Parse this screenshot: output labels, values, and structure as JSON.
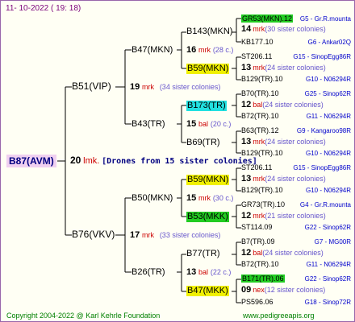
{
  "header": {
    "date": "11-  10-2022  ( 19:  18)"
  },
  "root": {
    "label": "B87(AVM)",
    "count": "20",
    "unit": "lmk.",
    "note": "[Drones from 15 sister colonies]"
  },
  "gen1": [
    {
      "label": "B51(VIP)",
      "count": "19",
      "unit": "mrk",
      "note": "(34 sister colonies)"
    },
    {
      "label": "B76(VKV)",
      "count": "17",
      "unit": "mrk",
      "note": "(33 sister colonies)"
    }
  ],
  "gen2": [
    {
      "label": "B47(MKN)",
      "count": "16",
      "unit": "mrk",
      "note": "(28 c.)"
    },
    {
      "label": "B43(TR)",
      "count": "15",
      "unit": "bal",
      "note": "(20 c.)"
    },
    {
      "label": "B50(MKN)",
      "count": "15",
      "unit": "mrk",
      "note": "(30 c.)"
    },
    {
      "label": "B26(TR)",
      "count": "13",
      "unit": "bal",
      "note": "(22 c.)"
    }
  ],
  "gen3": [
    {
      "label": "B143(MKN)"
    },
    {
      "label": "B59(MKN)"
    },
    {
      "label": "B173(TR)"
    },
    {
      "label": "B69(TR)"
    },
    {
      "label": "B59(MKN)"
    },
    {
      "label": "B53(MKK)"
    },
    {
      "label": "B77(TR)"
    },
    {
      "label": "B47(MKK)"
    }
  ],
  "gen4": [
    {
      "sire": "GR53(MKN).12",
      "queen": "G5 - Gr.R.mounta"
    },
    {
      "count": "14",
      "unit": "mrk",
      "note": "(30 sister colonies)"
    },
    {
      "sire": "KB177.10",
      "queen": "G6 - Ankar02Q"
    },
    {
      "sire": "ST206.11",
      "queen": "G15 - SinopEgg86R"
    },
    {
      "count": "13",
      "unit": "mrk",
      "note": "(24 sister colonies)"
    },
    {
      "sire": "B129(TR).10",
      "queen": "G10 - N06294R"
    },
    {
      "sire": "B70(TR).10",
      "queen": "G25 - Sinop62R"
    },
    {
      "count": "12",
      "unit": "bal",
      "note": "(24 sister colonies)"
    },
    {
      "sire": "B72(TR).10",
      "queen": "G11 - N06294R"
    },
    {
      "sire": "B63(TR).12",
      "queen": "G9 - Kangaroo98R"
    },
    {
      "count": "13",
      "unit": "mrk",
      "note": "(24 sister colonies)"
    },
    {
      "sire": "B129(TR).10",
      "queen": "G10 - N06294R"
    },
    {
      "sire": "ST206.11",
      "queen": "G15 - SinopEgg86R"
    },
    {
      "count": "13",
      "unit": "mrk",
      "note": "(24 sister colonies)"
    },
    {
      "sire": "B129(TR).10",
      "queen": "G10 - N06294R"
    },
    {
      "sire": "GR73(TR).10",
      "queen": "G4 - Gr.R.mounta"
    },
    {
      "count": "12",
      "unit": "mrk",
      "note": "(21 sister colonies)"
    },
    {
      "sire": "ST114.09",
      "queen": "G22 - Sinop62R"
    },
    {
      "sire": "B7(TR).09",
      "queen": "G7 - MG00R"
    },
    {
      "count": "12",
      "unit": "bal",
      "note": "(24 sister colonies)"
    },
    {
      "sire": "B72(TR).10",
      "queen": "G11 - N06294R"
    },
    {
      "sire": "B171(TR).06",
      "queen": "G22 - Sinop62R"
    },
    {
      "count": "09",
      "unit": "nex",
      "note": "(12 sister colonies)"
    },
    {
      "sire": "PS596.06",
      "queen": "G18 - Sinop72R"
    }
  ],
  "footer": {
    "copyright": "Copyright 2004-2022 @ Karl Kehrle Foundation",
    "site": "www.pedigreeapis.org"
  },
  "colors": {
    "green": "#22cc22",
    "yellow": "#f0f000",
    "cyan": "#22e0e0",
    "frame": "#9966aa",
    "root_bg": "#f0d0f0"
  }
}
